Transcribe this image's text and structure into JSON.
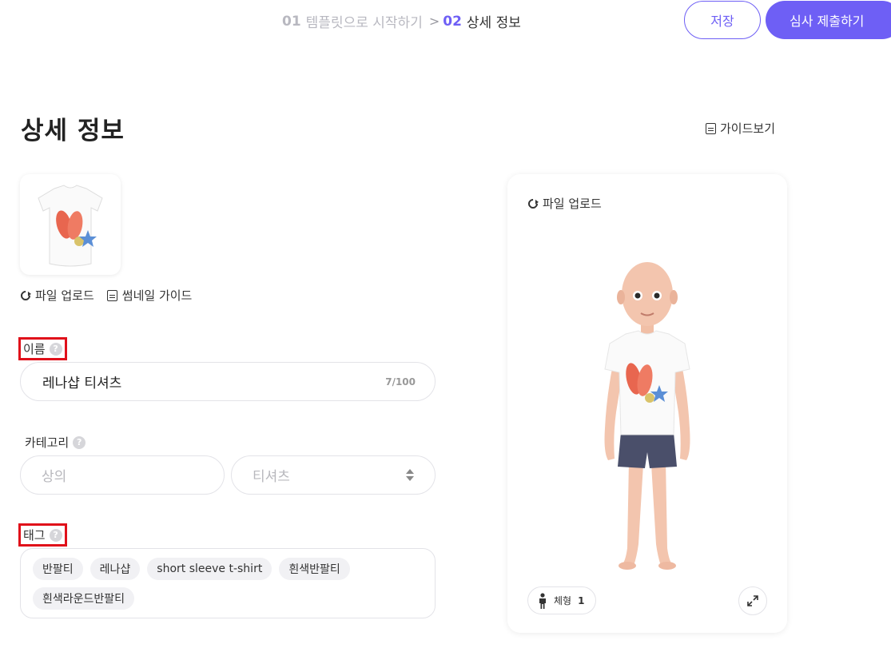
{
  "header": {
    "step1_num": "01",
    "step1_label": "템플릿으로 시작하기",
    "step_separator": ">",
    "step2_num": "02",
    "step2_label": "상세 정보",
    "save_label": "저장",
    "submit_label": "심사 제출하기",
    "accent_color": "#6e5ff5"
  },
  "page": {
    "title": "상세 정보",
    "guide_label": "가이드보기"
  },
  "thumbnail": {
    "upload_label": "파일 업로드",
    "guide_label": "썸네일 가이드"
  },
  "name_field": {
    "label": "이름",
    "value": "레나샵 티셔츠",
    "counter": "7/100"
  },
  "category_field": {
    "label": "카테고리",
    "primary_placeholder": "상의",
    "secondary_placeholder": "티셔츠"
  },
  "tags_field": {
    "label": "태그",
    "tags": [
      "반팔티",
      "레나샵",
      "short sleeve t-shirt",
      "흰색반팔티",
      "흰색라운드반팔티"
    ]
  },
  "preview": {
    "upload_label": "파일 업로드",
    "body_type_label": "체형",
    "body_type_value": "1"
  },
  "icons": {
    "refresh": "refresh-icon",
    "document": "document-icon",
    "help": "help-icon",
    "person": "person-icon",
    "expand": "expand-icon"
  }
}
